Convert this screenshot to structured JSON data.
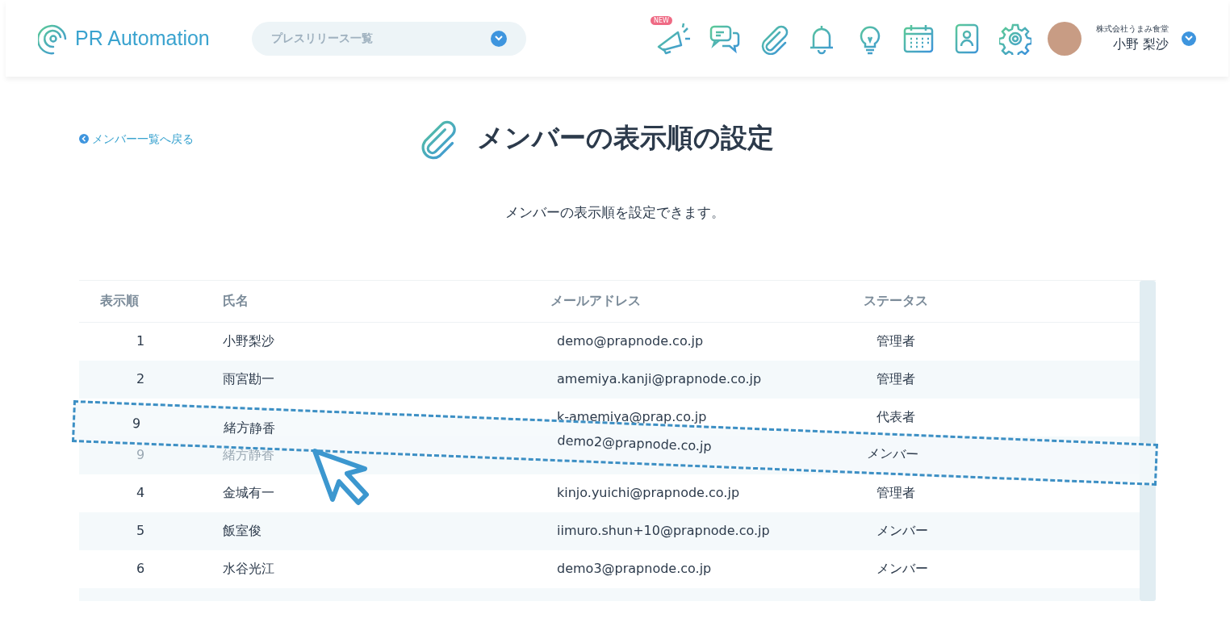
{
  "header": {
    "logo": "PR Automation",
    "page_select": {
      "value": "プレスリリース一覧"
    },
    "new_badge": "NEW",
    "company": "株式会社うまみ食堂",
    "user": "小野 梨沙"
  },
  "back_link": "メンバー一覧へ戻る",
  "title": "メンバーの表示順の設定",
  "description": "メンバーの表示順を設定できます。",
  "table": {
    "columns": [
      "表示順",
      "氏名",
      "メールアドレス",
      "ステータス"
    ],
    "rows": [
      {
        "kind": "row",
        "order": "1",
        "name": "小野梨沙",
        "email": "demo@prapnode.co.jp",
        "status": "管理者"
      },
      {
        "kind": "row",
        "order": "2",
        "name": "雨宮勘一",
        "email": "amemiya.kanji@prapnode.co.jp",
        "status": "管理者"
      },
      {
        "kind": "row",
        "email": "k-amemiya@prap.co.jp",
        "status": "代表者"
      },
      {
        "kind": "placeholder",
        "order": "9",
        "name": "緒方静香"
      },
      {
        "kind": "row",
        "order": "4",
        "name": "金城有一",
        "email": "kinjo.yuichi@prapnode.co.jp",
        "status": "管理者"
      },
      {
        "kind": "row",
        "order": "5",
        "name": "飯室俊",
        "email": "iimuro.shun+10@prapnode.co.jp",
        "status": "メンバー"
      },
      {
        "kind": "row",
        "order": "6",
        "name": "水谷光江",
        "email": "demo3@prapnode.co.jp",
        "status": "メンバー"
      }
    ],
    "dragged_row": {
      "order": "9",
      "name": "緒方静香",
      "email": "demo2@prapnode.co.jp",
      "status": "メンバー"
    }
  }
}
